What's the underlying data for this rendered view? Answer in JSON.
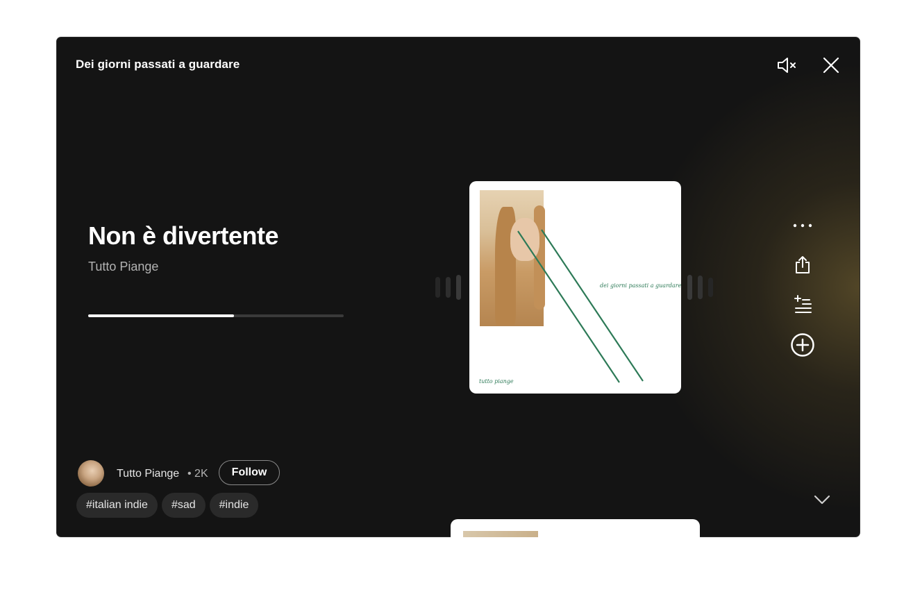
{
  "header": {
    "title": "Dei giorni passati a guardare"
  },
  "controls": {
    "mute_icon": "volume-muted-icon",
    "close_icon": "close-icon"
  },
  "track": {
    "title": "Non è divertente",
    "artist": "Tutto Piange",
    "progress": 0.57
  },
  "album_art": {
    "text_top": "dei giorni passati a guardare",
    "text_bottom": "tutto piange",
    "line_color": "#2d7a57"
  },
  "side_actions": [
    {
      "icon": "more-icon"
    },
    {
      "icon": "share-icon"
    },
    {
      "icon": "add-to-queue-icon"
    },
    {
      "icon": "add-circle-icon"
    }
  ],
  "creator": {
    "name": "Tutto Piange",
    "followers": "• 2K",
    "follow_label": "Follow"
  },
  "tags": [
    "#italian indie",
    "#sad",
    "#indie"
  ],
  "colors": {
    "background": "#141414",
    "accent_glow": "#5c4e2a",
    "text_primary": "#ffffff",
    "text_secondary": "#b3b3b3"
  }
}
